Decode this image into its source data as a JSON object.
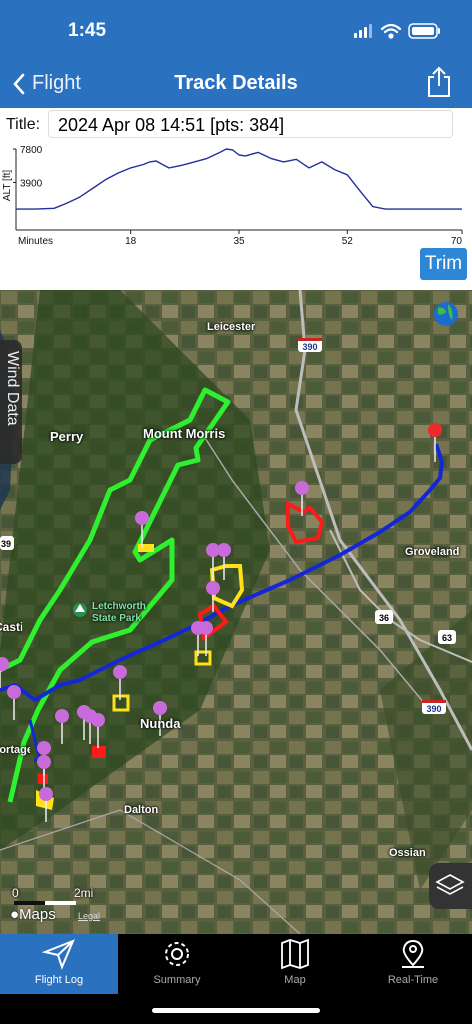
{
  "status": {
    "time": "1:45"
  },
  "nav": {
    "back_label": "Flight",
    "title": "Track Details"
  },
  "title_row": {
    "label": "Title:",
    "value": "2024 Apr 08  14:51 [pts: 384]"
  },
  "chart_data": {
    "type": "line",
    "ylabel": "ALT [ft]",
    "xlabel": "Minutes",
    "yticks": [
      "7800",
      "3900"
    ],
    "xticks": [
      "18",
      "35",
      "52",
      "70"
    ],
    "xlim": [
      0,
      70
    ],
    "ylim": [
      0,
      7800
    ],
    "x": [
      0,
      3,
      6,
      8,
      10,
      12,
      14,
      16,
      18,
      20,
      21,
      22,
      23,
      24,
      26,
      28,
      30,
      32,
      33,
      34,
      35,
      36,
      38,
      40,
      42,
      44,
      46,
      48,
      50,
      52,
      54,
      56,
      58,
      60,
      65,
      70
    ],
    "y": [
      800,
      800,
      900,
      1500,
      2200,
      3200,
      4200,
      5000,
      5600,
      6000,
      6300,
      6400,
      6000,
      5600,
      5900,
      6300,
      6700,
      7400,
      7800,
      7700,
      7100,
      7000,
      7400,
      6700,
      6300,
      6600,
      5600,
      6300,
      5400,
      4800,
      2900,
      1100,
      800,
      800,
      800,
      800
    ],
    "line_color": "#24309c"
  },
  "trim_label": "Trim",
  "wind_label": "Wind Data",
  "map": {
    "places": [
      {
        "name": "Leicester"
      },
      {
        "name": "Mount Morris"
      },
      {
        "name": "Perry"
      },
      {
        "name": "Groveland"
      },
      {
        "name": "Letchworth"
      },
      {
        "name": "State Park"
      },
      {
        "name": "Nunda"
      },
      {
        "name": "Dalton"
      },
      {
        "name": "Ossian"
      },
      {
        "name": "Portageville"
      },
      {
        "name": "Castile"
      }
    ],
    "route_shields": [
      "390",
      "36",
      "63",
      "390",
      "39"
    ],
    "scale": {
      "zero": "0",
      "dist": "2mi"
    },
    "attribution": "Maps",
    "legal": "Legal"
  },
  "tabs": [
    {
      "label": "Flight Log",
      "icon": "paper-plane-icon",
      "active": true
    },
    {
      "label": "Summary",
      "icon": "gear-icon",
      "active": false
    },
    {
      "label": "Map",
      "icon": "map-icon",
      "active": false
    },
    {
      "label": "Real-Time",
      "icon": "location-pin-icon",
      "active": false
    }
  ]
}
